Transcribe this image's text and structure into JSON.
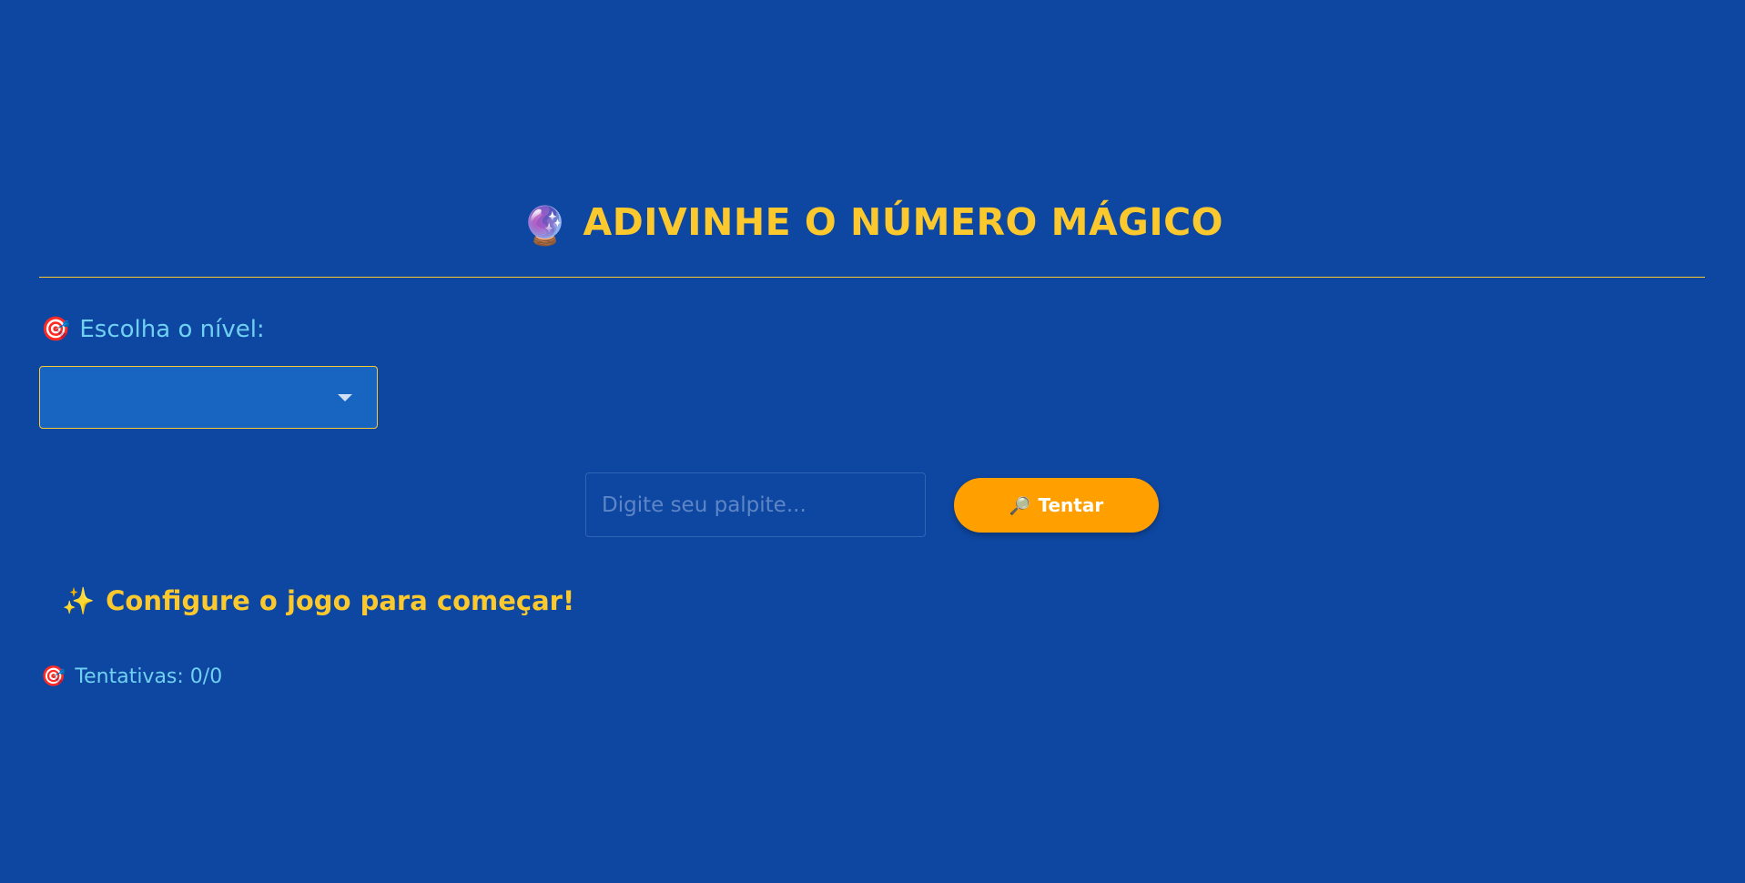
{
  "header": {
    "icon": "🔮",
    "title": "ADIVINHE O NÚMERO MÁGICO"
  },
  "level": {
    "icon": "🎯",
    "label": "Escolha o nível:",
    "selected_value": ""
  },
  "guess": {
    "placeholder": "Digite seu palpite...",
    "value": "",
    "button_icon": "🔎",
    "button_label": "Tentar"
  },
  "status": {
    "icon": "✨",
    "message": "Configure o jogo para começar!"
  },
  "attempts": {
    "icon": "🎯",
    "label": "Tentativas: 0/0"
  },
  "colors": {
    "background": "#0e47a1",
    "accent_yellow": "#fbc92d",
    "label_cyan": "#6fd0f2",
    "button_orange": "#ff9f00",
    "select_blue": "#1765c0"
  }
}
